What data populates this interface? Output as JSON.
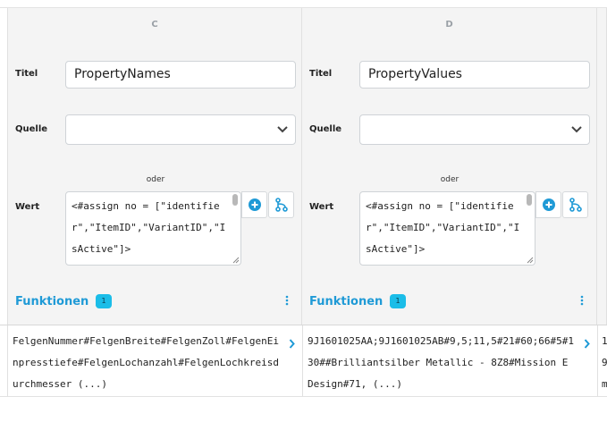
{
  "columns": [
    {
      "letter": "C",
      "title_label": "Titel",
      "title_value": "PropertyNames",
      "source_label": "Quelle",
      "source_value": "",
      "or_label": "oder",
      "value_label": "Wert",
      "value_code": "<#assign no = [\"identifier\",\"ItemID\",\"VariantID\",\"IsActive\"]>",
      "functions_label": "Funktionen",
      "functions_count": "1",
      "cell_value": "FelgenNummer#FelgenBreite#FelgenZoll#FelgenEinpresstiefe#FelgenLochanzahl#FelgenLochkreisdurchmesser (...)"
    },
    {
      "letter": "D",
      "title_label": "Titel",
      "title_value": "PropertyValues",
      "source_label": "Quelle",
      "source_value": "",
      "or_label": "oder",
      "value_label": "Wert",
      "value_code": "<#assign no = [\"identifier\",\"ItemID\",\"VariantID\",\"IsActive\"]>",
      "functions_label": "Funktionen",
      "functions_count": "1",
      "cell_value": "9J1601025AA;9J1601025AB#9,5;11,5#21#60;66#5#130##Brilliantsilber Metallic - 8Z8#Mission E Design#71, (...)"
    }
  ],
  "partial_column": {
    "cell_value": "1 9 m"
  },
  "colors": {
    "accent": "#1f9ad6",
    "badge": "#1bbde8",
    "panel_bg": "#f4f4f4"
  }
}
